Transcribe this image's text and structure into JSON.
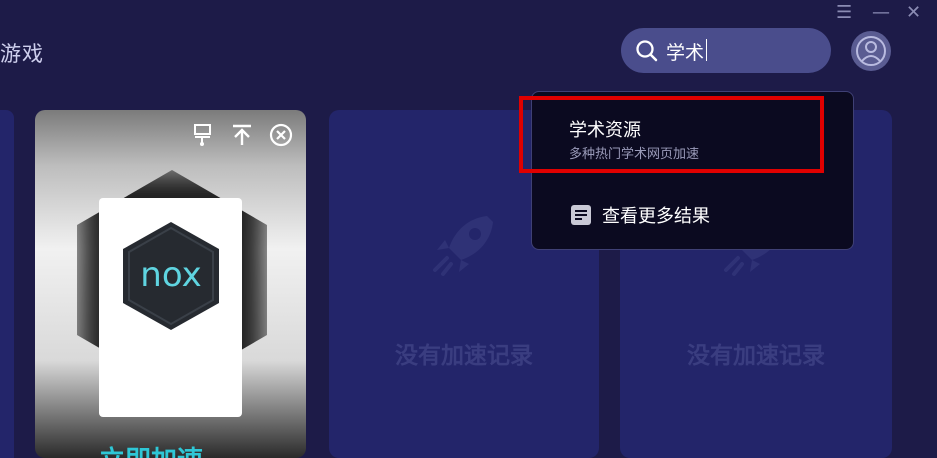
{
  "header": {
    "title_partial": "游戏",
    "window_controls": {
      "menu_icon": "menu-icon",
      "minimize_icon": "minimize-icon",
      "close_icon": "close-icon"
    },
    "search": {
      "value": "学术",
      "icon": "search-icon"
    },
    "avatar_icon": "user-icon"
  },
  "game_card": {
    "icons": [
      "pin-to-desktop-icon",
      "pin-top-icon",
      "remove-icon"
    ],
    "logo_text": "nox",
    "cta_label": "立即加速"
  },
  "empty_panels": [
    {
      "icon": "rocket-icon",
      "label": "没有加速记录"
    },
    {
      "icon": "rocket-icon",
      "label": "没有加速记录"
    }
  ],
  "search_dropdown": {
    "result": {
      "title": "学术资源",
      "subtitle": "多种热门学术网页加速"
    },
    "more": {
      "icon": "document-icon",
      "label": "查看更多结果"
    }
  },
  "colors": {
    "background": "#1d1b48",
    "panel": "#23256a",
    "search_bg": "#4a4d8c",
    "dropdown_bg": "#0b0a20",
    "highlight": "#e00000",
    "accent": "#2ec7d6"
  }
}
